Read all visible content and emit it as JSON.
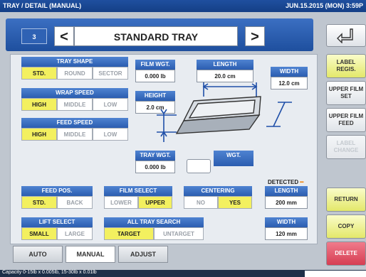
{
  "titlebar": {
    "left": "TRAY / DETAIL (MANUAL)",
    "right": "JUN.15.2015 (MON)  3:59P"
  },
  "header": {
    "tray_number": "3",
    "prev": "<",
    "tray_name": "STANDARD TRAY",
    "next": ">"
  },
  "tray_shape": {
    "label": "TRAY SHAPE",
    "options": [
      "STD.",
      "ROUND",
      "SECTOR"
    ],
    "selected": 0
  },
  "wrap_speed": {
    "label": "WRAP SPEED",
    "options": [
      "HIGH",
      "MIDDLE",
      "LOW"
    ],
    "selected": 0
  },
  "feed_speed": {
    "label": "FEED SPEED",
    "options": [
      "HIGH",
      "MIDDLE",
      "LOW"
    ],
    "selected": 0
  },
  "film_wgt": {
    "label": "FILM WGT.",
    "value": "0.000 lb"
  },
  "length": {
    "label": "LENGTH",
    "value": "20.0 cm"
  },
  "width": {
    "label": "WIDTH",
    "value": "12.0 cm"
  },
  "height": {
    "label": "HEIGHT",
    "value": "2.0 cm"
  },
  "tray_wgt": {
    "label": "TRAY WGT.",
    "value": "0.000 lb"
  },
  "wgt": {
    "label": "WGT.",
    "value": ""
  },
  "detected": {
    "label": "DETECTED",
    "length_label": "LENGTH",
    "length_value": "200 mm",
    "width_label": "WIDTH",
    "width_value": "120 mm"
  },
  "feed_pos": {
    "label": "FEED POS.",
    "options": [
      "STD.",
      "BACK"
    ],
    "selected": 0
  },
  "film_select": {
    "label": "FILM SELECT",
    "options": [
      "LOWER",
      "UPPER"
    ],
    "selected": 1
  },
  "centering": {
    "label": "CENTERING",
    "options": [
      "NO",
      "YES"
    ],
    "selected": 1
  },
  "lift_select": {
    "label": "LIFT SELECT",
    "options": [
      "SMALL",
      "LARGE"
    ],
    "selected": 0
  },
  "all_tray_search": {
    "label": "ALL TRAY SEARCH",
    "options": [
      "TARGET",
      "UNTARGET"
    ],
    "selected": 0
  },
  "right_buttons": {
    "back_icon": "return-arrow-icon",
    "label_regis_1": "LABEL",
    "label_regis_2": "REGIS.",
    "upper_film_set_1": "UPPER FILM",
    "upper_film_set_2": "SET",
    "upper_film_feed_1": "UPPER FILM",
    "upper_film_feed_2": "FEED",
    "label_change_1": "LABEL",
    "label_change_2": "CHANGE",
    "return": "RETURN",
    "copy": "COPY",
    "delete": "DELETE"
  },
  "tabs": [
    "AUTO",
    "MANUAL",
    "ADJUST"
  ],
  "active_tab": 1,
  "footer": {
    "capacity": "Capacity 0-15lb x 0.005lb, 15-30lb x 0.01lb"
  },
  "colors": {
    "accent": "#2b5db0",
    "selected": "#f3f05f",
    "delete": "#d63e53",
    "diagram": "#1f4fa8"
  }
}
